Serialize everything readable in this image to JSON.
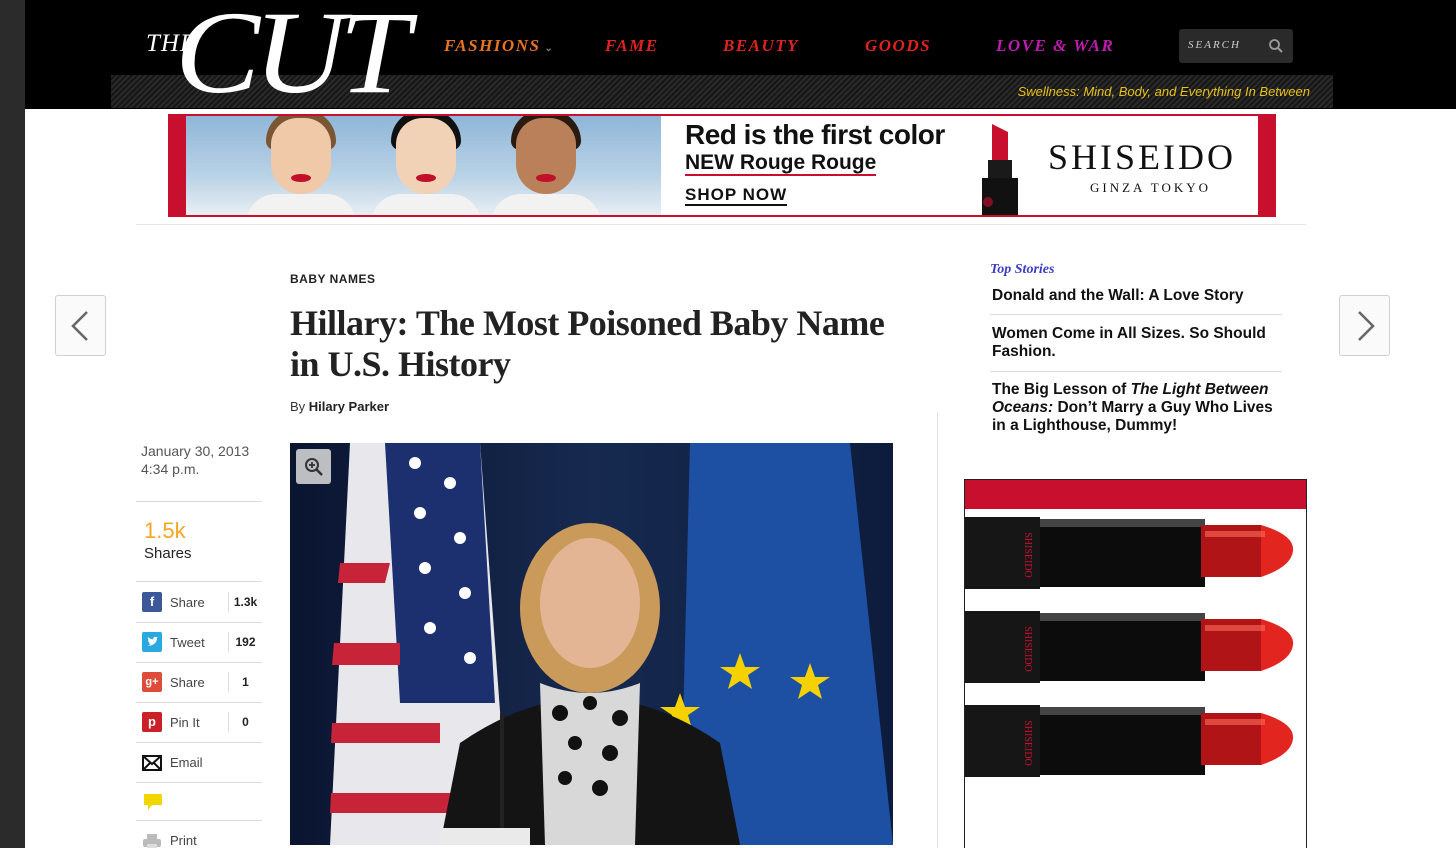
{
  "header": {
    "logo_the": "THE",
    "logo_cut": "CUT",
    "nav": [
      {
        "label": "FASHIONS",
        "color": "#e8741e",
        "has_dropdown": true
      },
      {
        "label": "FAME",
        "color": "#e0221e"
      },
      {
        "label": "BEAUTY",
        "color": "#e0221e"
      },
      {
        "label": "GOODS",
        "color": "#e0221e"
      },
      {
        "label": "LOVE & WAR",
        "color": "#c01ab0"
      }
    ],
    "search_placeholder": "SEARCH",
    "tagline": "Swellness: Mind, Body, and Everything In Between"
  },
  "banner_ad": {
    "headline": "Red is the first color",
    "subhead": "NEW Rouge Rouge",
    "cta": "SHOP NOW",
    "brand": "SHISEIDO",
    "brand_sub": "GINZA TOKYO"
  },
  "article": {
    "rubric": "BABY NAMES",
    "headline": "Hillary: The Most Poisoned Baby Name in U.S. History",
    "byline_prefix": "By",
    "author": "Hilary Parker",
    "date": "January 30, 2013",
    "time": "4:34 p.m."
  },
  "share": {
    "total": "1.5k",
    "total_label": "Shares",
    "buttons": [
      {
        "label": "Share",
        "count": "1.3k",
        "icon": "facebook-icon",
        "color": "#3b5998",
        "glyph": "f"
      },
      {
        "label": "Tweet",
        "count": "192",
        "icon": "twitter-icon",
        "color": "#2aa9e0",
        "glyph": "t"
      },
      {
        "label": "Share",
        "count": "1",
        "icon": "google-plus-icon",
        "color": "#dd4b39",
        "glyph": "g+"
      },
      {
        "label": "Pin It",
        "count": "0",
        "icon": "pinterest-icon",
        "color": "#cb2027",
        "glyph": "p"
      },
      {
        "label": "Email",
        "icon": "email-icon"
      },
      {
        "label": "",
        "icon": "comment-icon"
      },
      {
        "label": "Print",
        "icon": "print-icon"
      }
    ]
  },
  "top_stories": {
    "title": "Top Stories",
    "items": [
      {
        "text": "Donald and the Wall: A Love Story"
      },
      {
        "text": "Women Come in All Sizes. So Should Fashion."
      },
      {
        "pre": "The Big Lesson of ",
        "em": "The Light Between Oceans:",
        "post": " Don’t Marry a Guy Who Lives in a Lighthouse, Dummy!"
      }
    ]
  },
  "side_ad": {
    "brand": "SHISEIDO"
  }
}
